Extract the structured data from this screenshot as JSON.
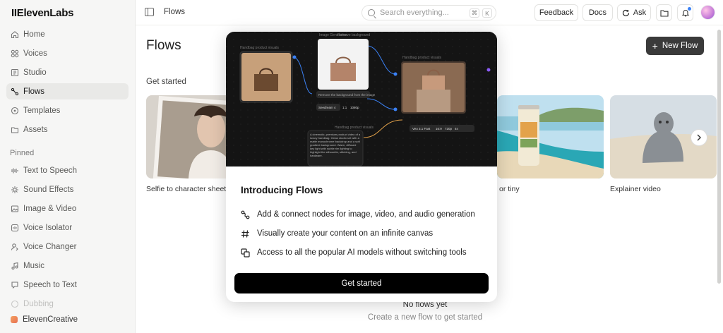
{
  "app": {
    "logo": "IIElevenLabs"
  },
  "sidebar": {
    "items": [
      {
        "label": "Home",
        "icon": "home-icon"
      },
      {
        "label": "Voices",
        "icon": "voices-icon"
      },
      {
        "label": "Studio",
        "icon": "studio-icon"
      },
      {
        "label": "Flows",
        "icon": "flows-icon",
        "active": true
      },
      {
        "label": "Templates",
        "icon": "templates-icon"
      },
      {
        "label": "Assets",
        "icon": "assets-icon"
      }
    ],
    "pinned_label": "Pinned",
    "pinned": [
      {
        "label": "Text to Speech",
        "icon": "text-to-speech-icon"
      },
      {
        "label": "Sound Effects",
        "icon": "sound-effects-icon"
      },
      {
        "label": "Image & Video",
        "icon": "image-video-icon"
      },
      {
        "label": "Voice Isolator",
        "icon": "voice-isolator-icon"
      },
      {
        "label": "Voice Changer",
        "icon": "voice-changer-icon"
      },
      {
        "label": "Music",
        "icon": "music-icon"
      },
      {
        "label": "Speech to Text",
        "icon": "speech-to-text-icon"
      },
      {
        "label": "Dubbing",
        "icon": "dubbing-icon"
      }
    ],
    "workspace": "ElevenCreative"
  },
  "topbar": {
    "breadcrumb": "Flows",
    "search_placeholder": "Search everything...",
    "search_kbd": [
      "⌘",
      "K"
    ],
    "feedback": "Feedback",
    "docs": "Docs",
    "ask": "Ask"
  },
  "main": {
    "title": "Flows",
    "new_flow": "New Flow",
    "get_started": "Get started",
    "templates": [
      {
        "label": "Selfie to character sheet"
      },
      {
        "label": "or tiny"
      },
      {
        "label": "Explainer video"
      }
    ],
    "empty_title": "No flows yet",
    "empty_subtitle": "Create a new flow to get started"
  },
  "modal": {
    "title": "Introducing Flows",
    "features": [
      {
        "text": "Add & connect nodes for image, video, and audio generation",
        "icon": "nodes-icon"
      },
      {
        "text": "Visually create your content on an infinite canvas",
        "icon": "hash-icon"
      },
      {
        "text": "Access to all the popular AI models without switching tools",
        "icon": "models-icon"
      }
    ],
    "cta": "Get started",
    "hero": {
      "node_prompt": "Remove the background from the image",
      "chip1": "Seedream 4",
      "chip2": "1:1",
      "chip3": "1080p",
      "chip4": "Veo 3.1 Fast",
      "chip5": "16:9",
      "chip6": "720p",
      "chip7": "4s",
      "label_product": "Handbag product visuals",
      "label_image": "Image Generation",
      "label_remove": "Remove background",
      "label_handbag": "Handbag product visuals",
      "label_prompt": "Handbag product visuals",
      "prompt_text": "A cinematic, premium product video of a luxury handbag. Clean studio set with a matte monochrome backdrop and a soft gradient background. Warm, diffused key light with subtle rim lighting to highlight the silhouette, stitching, and hardware."
    }
  },
  "colors": {
    "sidebar_bg": "#f6f6f5",
    "primary_button": "#3a3a3a",
    "cta": "#000000",
    "hero_bg": "#141414"
  }
}
